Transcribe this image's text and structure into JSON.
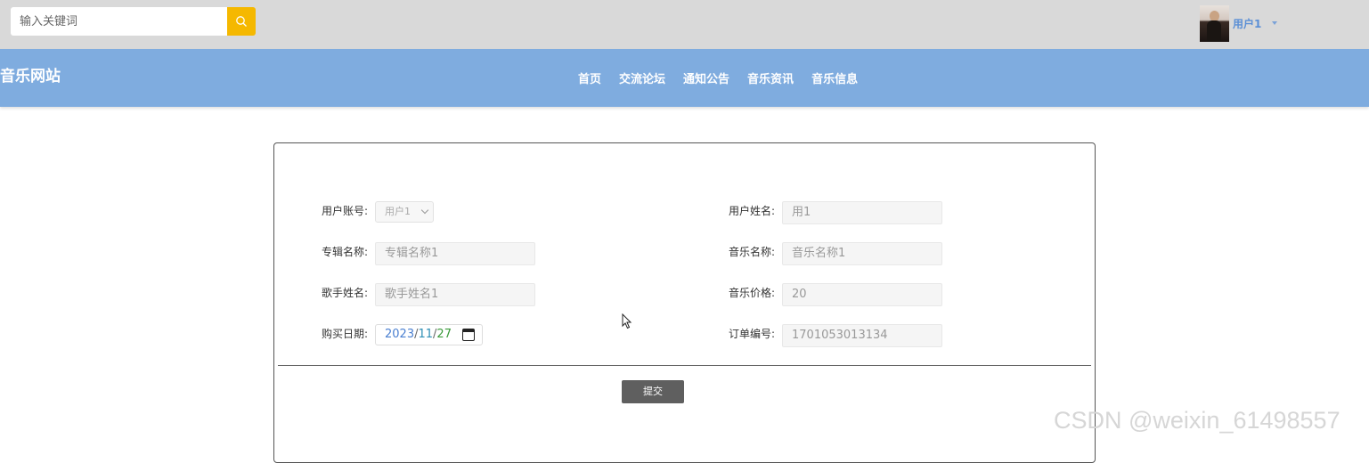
{
  "header": {
    "search_placeholder": "输入关键词",
    "user_name": "用户1"
  },
  "navbar": {
    "site_title": "音乐网站",
    "items": [
      "首页",
      "交流论坛",
      "通知公告",
      "音乐资讯",
      "音乐信息"
    ]
  },
  "form": {
    "fields": {
      "user_account": {
        "label": "用户账号:",
        "value": "用户1"
      },
      "user_name": {
        "label": "用户姓名:",
        "value": "用1"
      },
      "album_name": {
        "label": "专辑名称:",
        "value": "专辑名称1"
      },
      "music_name": {
        "label": "音乐名称:",
        "value": "音乐名称1"
      },
      "singer_name": {
        "label": "歌手姓名:",
        "value": "歌手姓名1"
      },
      "music_price": {
        "label": "音乐价格:",
        "value": "20"
      },
      "purchase_date": {
        "label": "购买日期:",
        "year": "2023",
        "month": "11",
        "day": "27"
      },
      "order_no": {
        "label": "订单编号:",
        "value": "1701053013134"
      }
    },
    "submit_label": "提交"
  },
  "watermark": "CSDN @weixin_61498557"
}
